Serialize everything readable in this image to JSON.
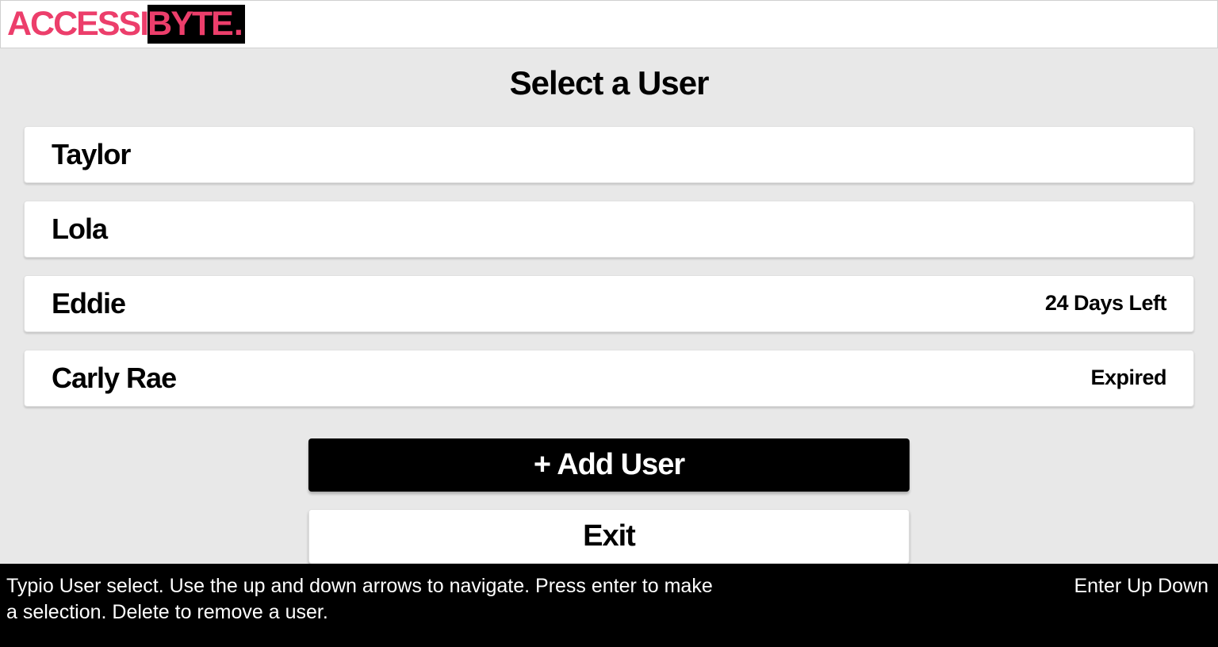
{
  "header": {
    "logo_part1": "ACCESSI",
    "logo_part2": "BYTE",
    "logo_dot": "."
  },
  "page_title": "Select a User",
  "users": [
    {
      "name": "Taylor",
      "status": ""
    },
    {
      "name": "Lola",
      "status": ""
    },
    {
      "name": "Eddie",
      "status": "24 Days Left"
    },
    {
      "name": "Carly Rae",
      "status": "Expired"
    }
  ],
  "buttons": {
    "add_user": "+ Add User",
    "exit": "Exit"
  },
  "footer": {
    "help_text": "Typio User select. Use the up and down arrows to navigate. Press enter to make a selection. Delete to remove a user.",
    "key_hints": "Enter Up Down"
  }
}
